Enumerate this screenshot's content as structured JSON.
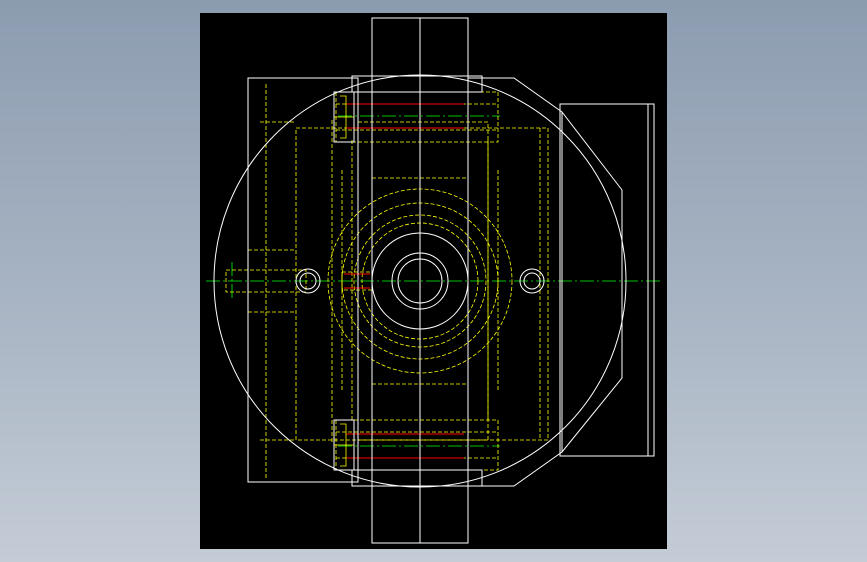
{
  "colors": {
    "background_gradient_top": "#8c9cb0",
    "background_gradient_bottom": "#c4ccd6",
    "viewport_background": "#000000",
    "visible_lines": "#ffffff",
    "hidden_lines": "#ffff00",
    "center_lines": "#00ff00",
    "thread_lines": "#ff0000"
  },
  "icons": {
    "bolt_symbol": "bolt-icon",
    "bolt_hole_symbol": "bolt-hole-icon"
  }
}
